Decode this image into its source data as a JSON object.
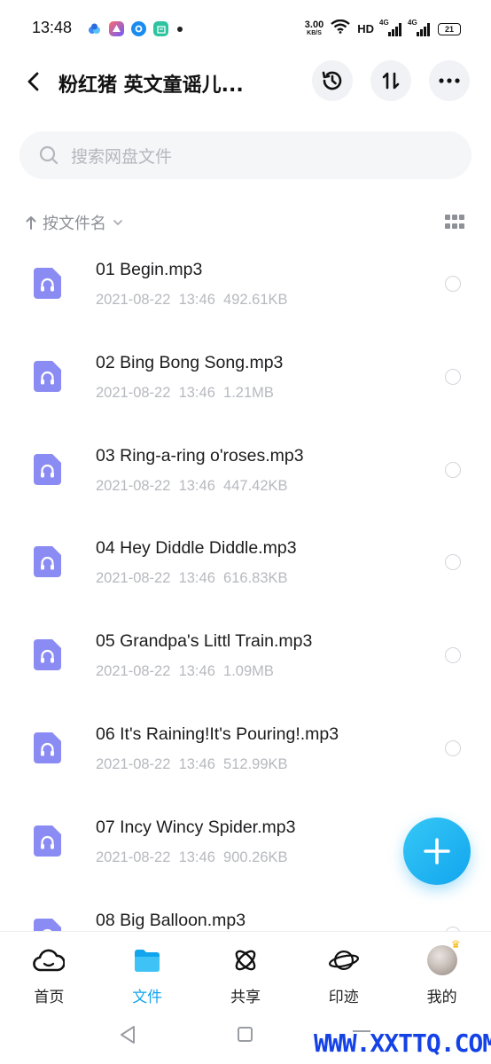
{
  "status_bar": {
    "time": "13:48",
    "speed_value": "3.00",
    "speed_unit": "KB/S",
    "hd_label": "HD",
    "signal_1": "4G",
    "signal_2": "4G",
    "battery": "21"
  },
  "header": {
    "title": "粉红猪 英文童谣儿...",
    "back_icon": "chevron-left-icon",
    "history_icon": "history-icon",
    "sort_icon": "sort-arrows-icon",
    "more_icon": "more-dots-icon"
  },
  "search": {
    "placeholder": "搜索网盘文件"
  },
  "sort": {
    "label": "按文件名"
  },
  "files": [
    {
      "name": "01 Begin.mp3",
      "date": "2021-08-22",
      "time": "13:46",
      "size": "492.61KB"
    },
    {
      "name": "02 Bing Bong Song.mp3",
      "date": "2021-08-22",
      "time": "13:46",
      "size": "1.21MB"
    },
    {
      "name": "03 Ring-a-ring o'roses.mp3",
      "date": "2021-08-22",
      "time": "13:46",
      "size": "447.42KB"
    },
    {
      "name": "04 Hey Diddle Diddle.mp3",
      "date": "2021-08-22",
      "time": "13:46",
      "size": "616.83KB"
    },
    {
      "name": "05 Grandpa's Littl Train.mp3",
      "date": "2021-08-22",
      "time": "13:46",
      "size": "1.09MB"
    },
    {
      "name": "06 It's Raining!It's Pouring!.mp3",
      "date": "2021-08-22",
      "time": "13:46",
      "size": "512.99KB"
    },
    {
      "name": "07 Incy Wincy Spider.mp3",
      "date": "2021-08-22",
      "time": "13:46",
      "size": "900.26KB"
    },
    {
      "name": "08 Big Balloon.mp3",
      "date": "",
      "time": "",
      "size": ""
    }
  ],
  "bottom_nav": [
    {
      "label": "首页",
      "icon": "cloud-home-icon"
    },
    {
      "label": "文件",
      "icon": "folder-icon",
      "active": true
    },
    {
      "label": "共享",
      "icon": "atom-share-icon"
    },
    {
      "label": "印迹",
      "icon": "planet-icon"
    },
    {
      "label": "我的",
      "icon": "avatar"
    }
  ],
  "watermark": "WWW.XXTTQ.COM",
  "colors": {
    "accent": "#12a5ee",
    "file_icon": "#8b8cf3",
    "text_primary": "#1c1c1e",
    "text_secondary": "#b7b9bf"
  }
}
